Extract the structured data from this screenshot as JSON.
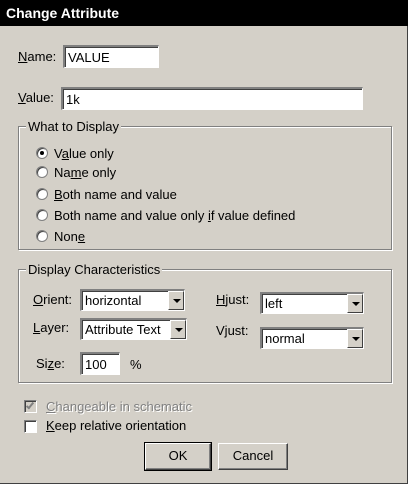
{
  "window": {
    "title": "Change Attribute"
  },
  "name_field": {
    "label": "Name:",
    "value": "VALUE"
  },
  "value_field": {
    "label": "Value:",
    "value": "1k"
  },
  "what_to_display": {
    "title": "What to Display",
    "options": [
      {
        "label": "Value only",
        "selected": true
      },
      {
        "label": "Name only",
        "selected": false
      },
      {
        "label": "Both name and value",
        "selected": false
      },
      {
        "label": "Both name and value only if value defined",
        "selected": false
      },
      {
        "label": "None",
        "selected": false
      }
    ]
  },
  "display_characteristics": {
    "title": "Display Characteristics",
    "orient": {
      "label": "Orient:",
      "value": "horizontal"
    },
    "layer": {
      "label": "Layer:",
      "value": "Attribute Text"
    },
    "size": {
      "label": "Size:",
      "value": "100",
      "unit": "%"
    },
    "hjust": {
      "label": "Hjust:",
      "value": "left"
    },
    "vjust": {
      "label": "Vjust:",
      "value": "normal"
    }
  },
  "changeable": {
    "label": "Changeable in schematic",
    "checked": true,
    "disabled": true
  },
  "keep_relative": {
    "label": "Keep relative orientation",
    "checked": false
  },
  "buttons": {
    "ok": "OK",
    "cancel": "Cancel"
  }
}
